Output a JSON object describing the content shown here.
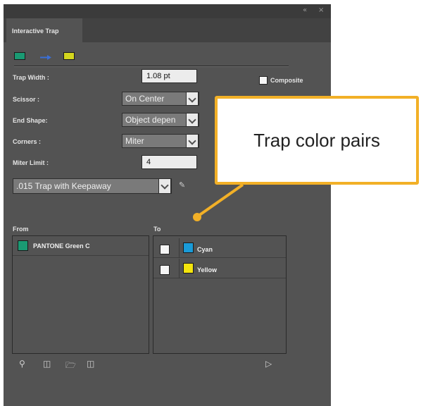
{
  "panel": {
    "tab_label": "Interactive Trap",
    "titlebar_buttons": [
      "«",
      "×"
    ]
  },
  "swatches": {
    "colors": [
      "#1a9a73",
      "#3b6fd6",
      "#d4d61e"
    ]
  },
  "fields": {
    "trap_width_label": "Trap Width :",
    "trap_width_value": "1.08 pt",
    "composite_label": "Composite",
    "scissor_label": "Scissor :",
    "scissor_value": "On Center",
    "end_shape_label": "End Shape:",
    "end_shape_value": "Object depen",
    "corners_label": "Corners :",
    "corners_value": "Miter",
    "miter_limit_label": "Miter Limit :",
    "miter_limit_value": "4",
    "preset_value": ".015 Trap with Keepaway"
  },
  "lists": {
    "from_header": "From",
    "to_header": "To",
    "from_items": [
      {
        "name": "PANTONE Green C",
        "color": "#1a9a73"
      }
    ],
    "to_items": [
      {
        "name": "Cyan",
        "color": "#1a9bd8"
      },
      {
        "name": "Yellow",
        "color": "#f5e50d"
      }
    ]
  },
  "callout": {
    "text": "Trap color pairs",
    "color": "#f2b027"
  }
}
